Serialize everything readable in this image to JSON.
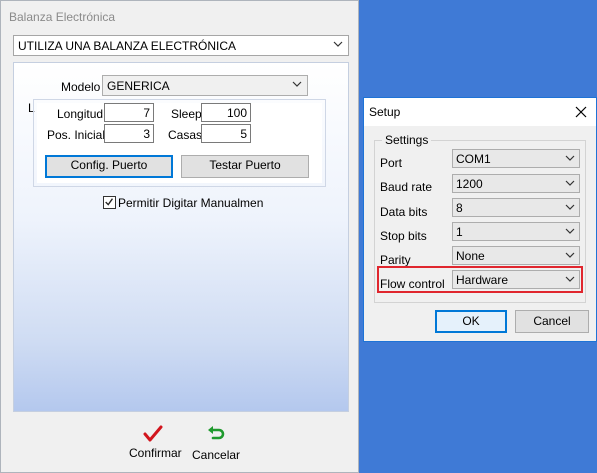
{
  "main_window": {
    "title": "Balanza Electrónica",
    "balance_mode": "UTILIZA UNA BALANZA ELECTRÓNICA",
    "modelo_label": "Modelo",
    "modelo_value": "GENERICA",
    "hidden_label_fragment": "L",
    "fields": {
      "longitud_label": "Longitud",
      "longitud_value": "7",
      "sleep_label": "Sleep",
      "sleep_value": "100",
      "pos_inicial_label": "Pos. Inicial",
      "pos_inicial_value": "3",
      "casas_label": "Casas",
      "casas_value": "5"
    },
    "config_button": "Config. Puerto",
    "test_button": "Testar Puerto",
    "manual_checkbox_label": "Permitir Digitar Manualmen",
    "manual_checked": true,
    "confirm_label": "Confirmar",
    "cancel_label": "Cancelar"
  },
  "setup_dialog": {
    "title": "Setup",
    "group_label": "Settings",
    "rows": [
      {
        "label": "Port",
        "value": "COM1"
      },
      {
        "label": "Baud rate",
        "value": "1200"
      },
      {
        "label": "Data bits",
        "value": "8"
      },
      {
        "label": "Stop bits",
        "value": "1"
      },
      {
        "label": "Parity",
        "value": "None"
      },
      {
        "label": "Flow control",
        "value": "Hardware"
      }
    ],
    "ok_label": "OK",
    "cancel_label": "Cancel"
  },
  "colors": {
    "desktop": "#3f7ad6",
    "highlight": "#e0262e",
    "focus_accent": "#0078d7",
    "confirm_check": "#d2151d",
    "cancel_arrow": "#1f9a2e"
  },
  "icons": {
    "confirm": "checkmark-icon",
    "cancel": "undo-arrow-icon",
    "dropdown": "chevron-down-icon",
    "close": "close-icon"
  }
}
